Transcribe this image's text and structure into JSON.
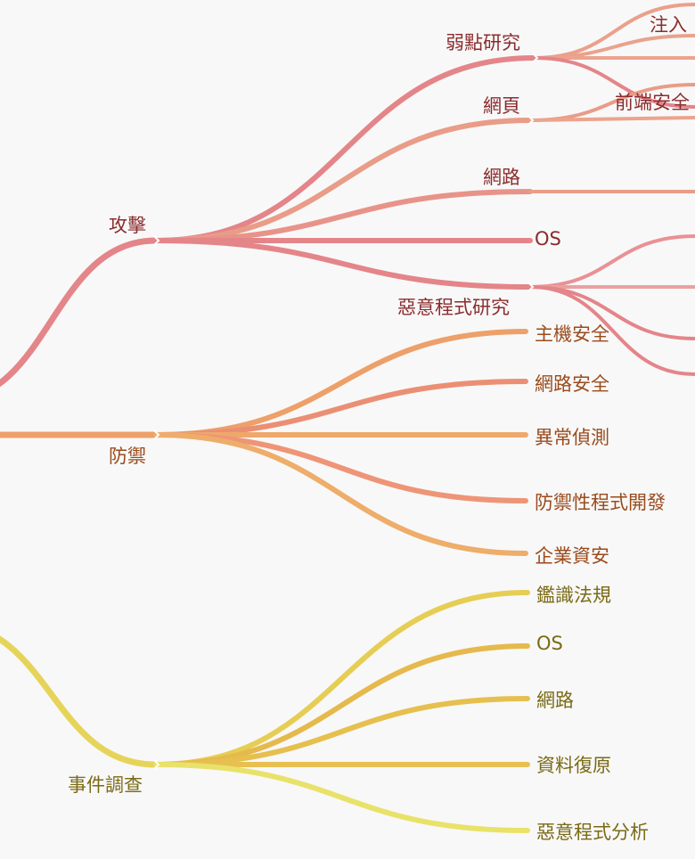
{
  "branches": {
    "attack": {
      "label": "攻擊",
      "color": "#e48589",
      "children": {
        "vuln": {
          "label": "弱點研究",
          "color": "#e48589",
          "children": {
            "injection": "注入",
            "frontend": "前端安全"
          }
        },
        "web": {
          "label": "網頁",
          "color": "#e99c88"
        },
        "network": {
          "label": "網路",
          "color": "#e89389"
        },
        "os": {
          "label": "OS",
          "color": "#e48589"
        },
        "malware_research": {
          "label": "惡意程式研究",
          "color": "#e48589"
        }
      }
    },
    "defense": {
      "label": "防禦",
      "color": "#eda069",
      "children": {
        "host_security": {
          "label": "主機安全",
          "color": "#eda069"
        },
        "network_security": {
          "label": "網路安全",
          "color": "#eb8f74"
        },
        "anomaly_detection": {
          "label": "異常偵測",
          "color": "#efa86a"
        },
        "defensive_programming": {
          "label": "防禦性程式開發",
          "color": "#ee9577"
        },
        "enterprise_security": {
          "label": "企業資安",
          "color": "#eead6a"
        }
      }
    },
    "investigation": {
      "label": "事件調查",
      "color": "#e6d45a",
      "children": {
        "forensics_law": {
          "label": "鑑識法規",
          "color": "#e6cd54"
        },
        "os": {
          "label": "OS",
          "color": "#e6b94c"
        },
        "network": {
          "label": "網路",
          "color": "#e6bf4e"
        },
        "data_recovery": {
          "label": "資料復原",
          "color": "#e7c051"
        },
        "malware_analysis": {
          "label": "惡意程式分析",
          "color": "#e9e26a"
        }
      }
    }
  },
  "colors": {
    "background": "#f8f8f8",
    "attack_text": "#8b2c2e",
    "defense_text": "#9a4b1c",
    "investigation_text": "#7a6a16"
  }
}
